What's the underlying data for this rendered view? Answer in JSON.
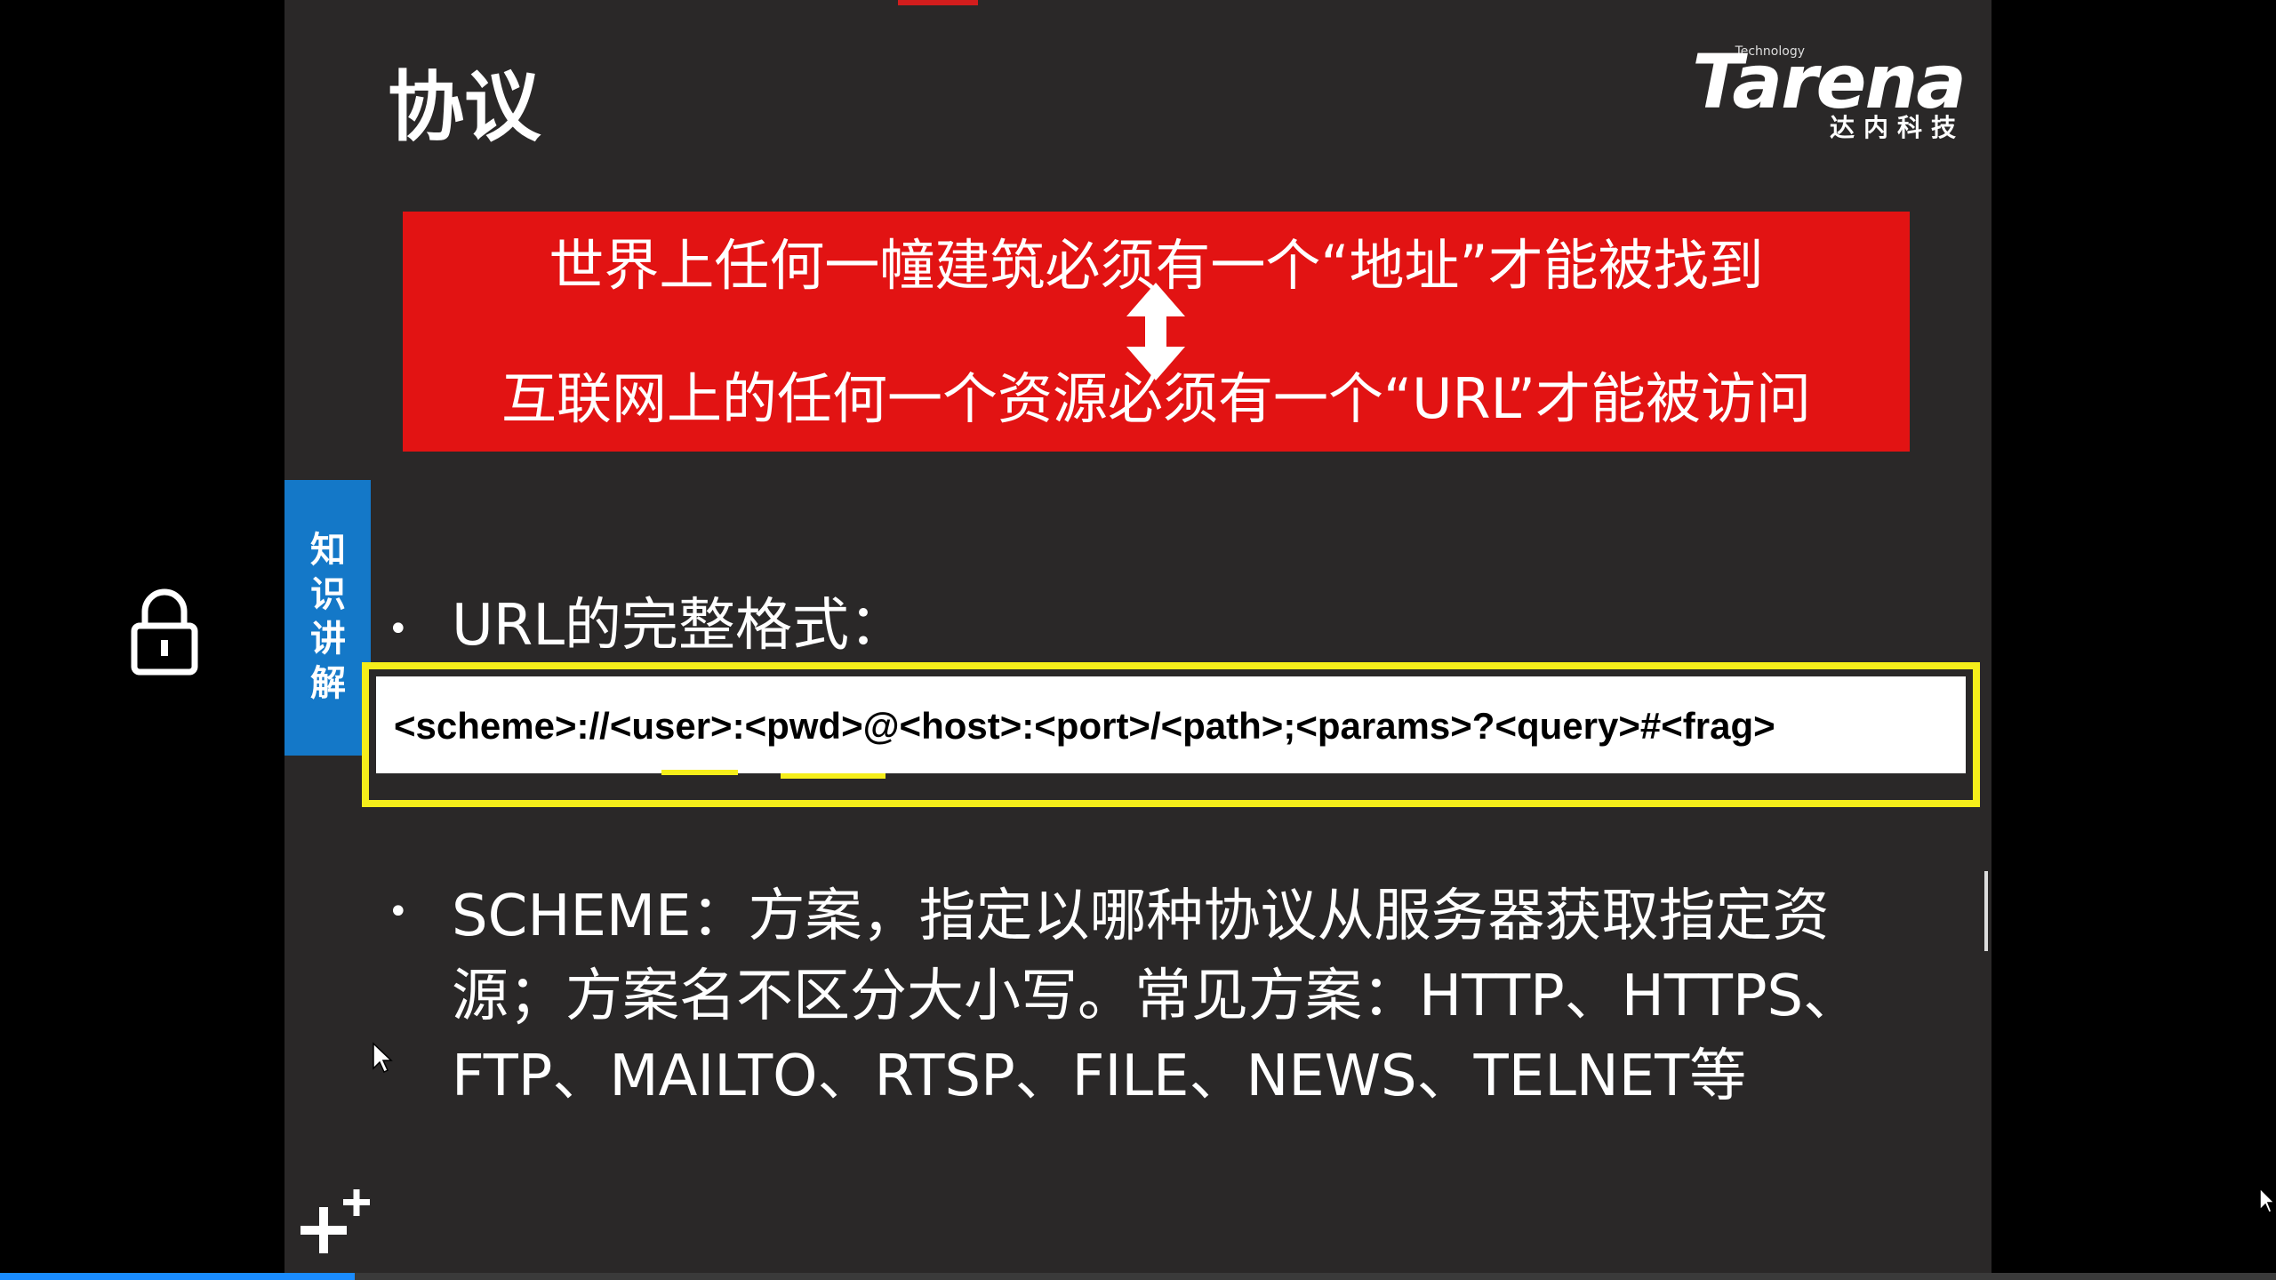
{
  "slide": {
    "title": "协议",
    "logo": {
      "tech": "Technology",
      "word": "Tarena",
      "cn": "达内科技"
    },
    "red_box": {
      "line1": "世界上任何一幢建筑必须有一个“地址”才能被找到",
      "line2": "互联网上的任何一个资源必须有一个“URL”才能被访问"
    },
    "side_tab": "知识讲解",
    "bullet_dot": "•",
    "bullet1": "URL的完整格式：",
    "url_format": "<scheme>://<user>:<pwd>@<host>:<port>/<path>;<params>?<query>#<frag>",
    "bullet2": "SCHEME：方案，指定以哪种协议从服务器获取指定资源；方案名不区分大小写。常见方案：HTTP、HTTPS、FTP、MAILTO、RTSP、FILE、NEWS、TELNET等"
  },
  "player": {
    "progress": 0.156
  },
  "colors": {
    "slide_bg": "#2a2828",
    "red_box": "#e21313",
    "side_tab": "#1478c8",
    "highlight": "#f5ee1a",
    "progress": "#1a8cff"
  }
}
